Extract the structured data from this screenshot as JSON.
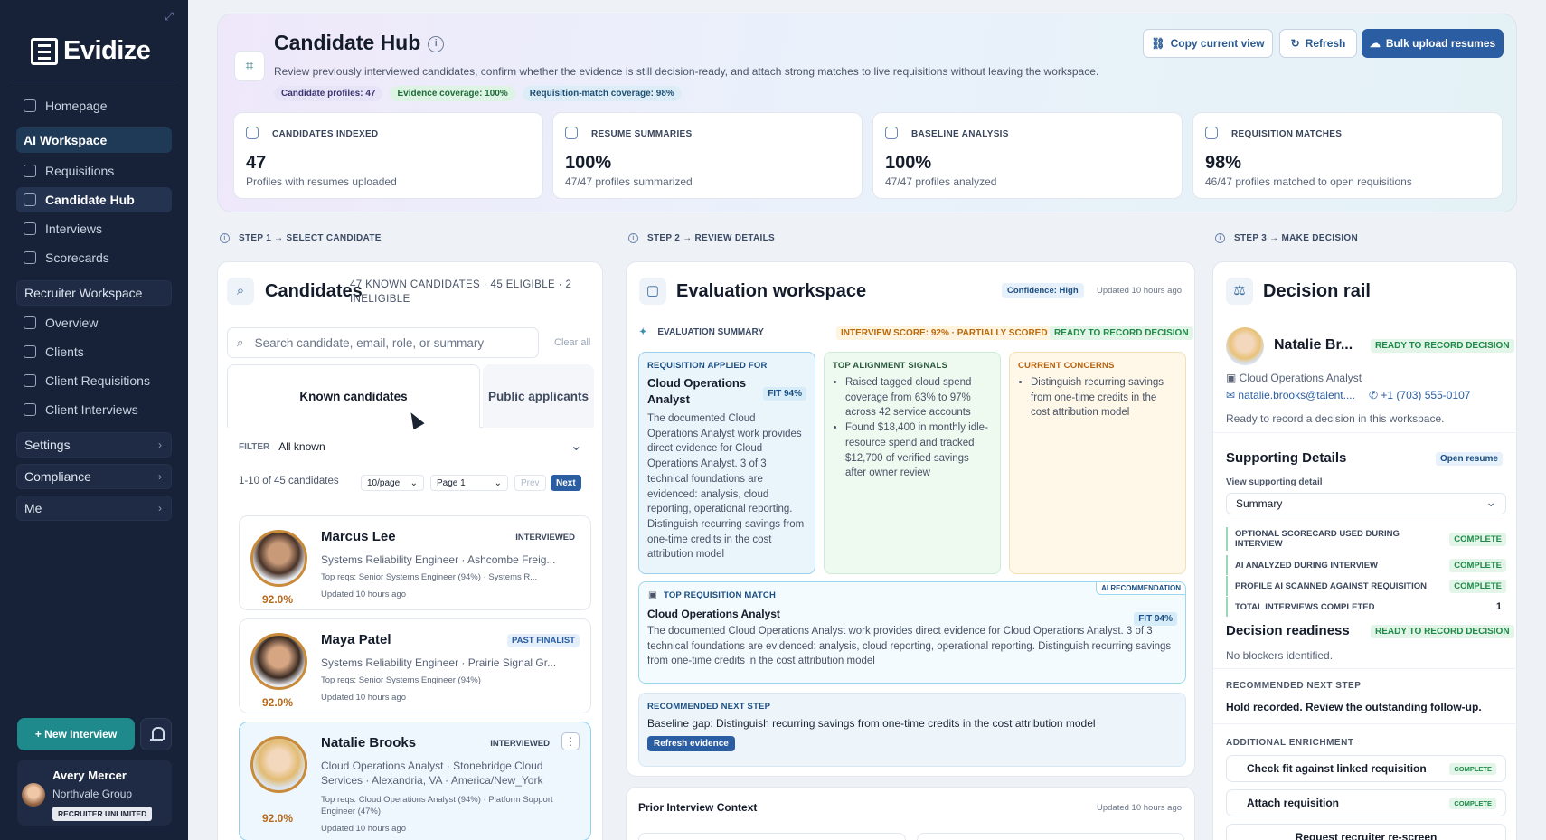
{
  "sidebar": {
    "logo": "Evidize",
    "items": [
      {
        "label": "Homepage",
        "icon": "home-icon"
      },
      {
        "label": "AI Workspace"
      },
      {
        "label": "Requisitions",
        "icon": "briefcase-icon"
      },
      {
        "label": "Candidate Hub",
        "icon": "scan-user-icon"
      },
      {
        "label": "Interviews",
        "icon": "calendar-icon"
      },
      {
        "label": "Scorecards",
        "icon": "clipboard-icon"
      },
      {
        "label": "Recruiter Workspace"
      },
      {
        "label": "Overview",
        "icon": "grid-icon"
      },
      {
        "label": "Clients",
        "icon": "building-icon"
      },
      {
        "label": "Client Requisitions",
        "icon": "briefcase-icon"
      },
      {
        "label": "Client Interviews",
        "icon": "calendar-icon"
      },
      {
        "label": "Settings"
      },
      {
        "label": "Compliance"
      },
      {
        "label": "Me"
      }
    ],
    "new_interview": "+ New Interview",
    "user": {
      "name": "Avery Mercer",
      "org": "Northvale Group",
      "plan": "RECRUITER UNLIMITED"
    }
  },
  "hero": {
    "title": "Candidate Hub",
    "subtitle": "Review previously interviewed candidates, confirm whether the evidence is still decision-ready, and attach strong matches to live requisitions without leaving the workspace.",
    "chips": [
      "Candidate profiles: 47",
      "Evidence coverage: 100%",
      "Requisition-match coverage: 98%"
    ],
    "buttons": {
      "copy": "Copy current view",
      "refresh": "Refresh",
      "bulk": "Bulk upload resumes"
    },
    "stats": [
      {
        "label": "CANDIDATES INDEXED",
        "value": "47",
        "desc": "Profiles with resumes uploaded"
      },
      {
        "label": "RESUME SUMMARIES",
        "value": "100%",
        "desc": "47/47 profiles summarized"
      },
      {
        "label": "BASELINE ANALYSIS",
        "value": "100%",
        "desc": "47/47 profiles analyzed"
      },
      {
        "label": "REQUISITION MATCHES",
        "value": "98%",
        "desc": "46/47 profiles matched to open requisitions"
      }
    ]
  },
  "steps": [
    "STEP 1 → SELECT CANDIDATE",
    "STEP 2 → REVIEW DETAILS",
    "STEP 3 → MAKE DECISION"
  ],
  "candidates": {
    "title": "Candidates",
    "counts": "47 KNOWN CANDIDATES · 45 ELIGIBLE · 2 INELIGIBLE",
    "search_placeholder": "Search candidate, email, role, or summary",
    "clear": "Clear all",
    "tabs": [
      "Known candidates",
      "Public applicants"
    ],
    "filter_label": "FILTER",
    "filter_value": "All known",
    "range": "1-10 of 45 candidates",
    "per_page": "10/page",
    "page": "Page 1",
    "prev": "Prev",
    "next": "Next",
    "list": [
      {
        "name": "Marcus Lee",
        "tag": "INTERVIEWED",
        "role": "Systems Reliability Engineer · Ashcombe Freig...",
        "reqs": "Top reqs: Senior Systems Engineer (94%) · Systems R...",
        "updated": "Updated 10 hours ago",
        "score": "92.0%"
      },
      {
        "name": "Maya Patel",
        "tag": "PAST FINALIST",
        "role": "Systems Reliability Engineer · Prairie Signal Gr...",
        "reqs": "Top reqs: Senior Systems Engineer (94%)",
        "updated": "Updated 10 hours ago",
        "score": "92.0%"
      },
      {
        "name": "Natalie Brooks",
        "tag": "INTERVIEWED",
        "role": "Cloud Operations Analyst · Stonebridge Cloud Services · Alexandria, VA · America/New_York",
        "reqs": "Top reqs: Cloud Operations Analyst (94%) · Platform Support Engineer (47%)",
        "updated": "Updated 10 hours ago",
        "score": "92.0%"
      }
    ]
  },
  "evaluation": {
    "title": "Evaluation workspace",
    "confidence": "Confidence: High",
    "updated": "Updated 10 hours ago",
    "summary_label": "EVALUATION SUMMARY",
    "score_pill": "INTERVIEW SCORE: 92% · PARTIALLY SCORED",
    "ready_pill": "READY TO RECORD DECISION",
    "req_box": {
      "label": "REQUISITION APPLIED FOR",
      "title": "Cloud Operations Analyst",
      "fit": "FIT 94%",
      "text": "The documented Cloud Operations Analyst work provides direct evidence for Cloud Operations Analyst. 3 of 3 technical foundations are evidenced: analysis, cloud reporting, operational reporting. Distinguish recurring savings from one-time credits in the cost attribution model"
    },
    "signals": {
      "label": "TOP ALIGNMENT SIGNALS",
      "items": [
        "Raised tagged cloud spend coverage from 63% to 97% across 42 service accounts",
        "Found $18,400 in monthly idle-resource spend and tracked $12,700 of verified savings after owner review"
      ]
    },
    "concerns": {
      "label": "CURRENT CONCERNS",
      "items": [
        "Distinguish recurring savings from one-time credits in the cost attribution model"
      ]
    },
    "top_match": {
      "label": "TOP REQUISITION MATCH",
      "badge": "AI RECOMMENDATION",
      "title": "Cloud Operations Analyst",
      "fit": "FIT 94%",
      "text": "The documented Cloud Operations Analyst work provides direct evidence for Cloud Operations Analyst. 3 of 3 technical foundations are evidenced: analysis, cloud reporting, operational reporting. Distinguish recurring savings from one-time credits in the cost attribution model"
    },
    "next_step": {
      "label": "RECOMMENDED NEXT STEP",
      "text": "Baseline gap: Distinguish recurring savings from one-time credits in the cost attribution model",
      "button": "Refresh evidence"
    }
  },
  "prior": {
    "title": "Prior Interview Context",
    "updated": "Updated 10 hours ago"
  },
  "decision": {
    "title": "Decision rail",
    "name": "Natalie Br...",
    "status": "READY TO RECORD DECISION",
    "role": "Cloud Operations Analyst",
    "email": "natalie.brooks@talent....",
    "phone": "+1 (703) 555-0107",
    "note": "Ready to record a decision in this workspace.",
    "supporting_title": "Supporting Details",
    "open_resume": "Open resume",
    "view_label": "View supporting detail",
    "view_value": "Summary",
    "rows": [
      {
        "label": "OPTIONAL SCORECARD USED DURING INTERVIEW",
        "status": "COMPLETE"
      },
      {
        "label": "AI ANALYZED DURING INTERVIEW",
        "status": "COMPLETE"
      },
      {
        "label": "PROFILE AI SCANNED AGAINST REQUISITION",
        "status": "COMPLETE"
      },
      {
        "label": "TOTAL INTERVIEWS COMPLETED",
        "status": "1"
      }
    ],
    "readiness_title": "Decision readiness",
    "readiness_status": "READY TO RECORD DECISION",
    "blockers": "No blockers identified.",
    "next_label": "RECOMMENDED NEXT STEP",
    "next_text": "Hold recorded. Review the outstanding follow-up.",
    "enrich_label": "ADDITIONAL ENRICHMENT",
    "enrichment": [
      {
        "label": "Check fit against linked requisition",
        "status": "COMPLETE"
      },
      {
        "label": "Attach requisition",
        "status": "COMPLETE"
      },
      {
        "label": "Request recruiter re-screen"
      }
    ]
  }
}
